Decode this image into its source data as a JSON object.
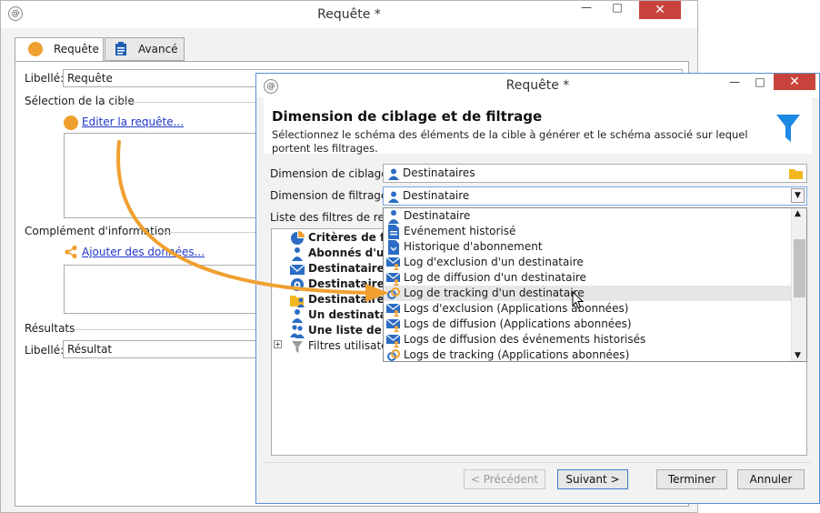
{
  "back_window": {
    "title": "Requête *",
    "tabs": [
      {
        "label": "Requête"
      },
      {
        "label": "Avancé"
      }
    ],
    "libelle_label": "Libellé:",
    "libelle_value": "Requête",
    "section_target": "Sélection de la cible",
    "edit_query_link": "Editer la requête...",
    "section_complement": "Complément d'information",
    "add_data_link": "Ajouter des données...",
    "section_results": "Résultats",
    "result_label": "Libellé:",
    "result_value": "Résultat"
  },
  "dialog": {
    "title": "Requête *",
    "header_title": "Dimension de ciblage et de filtrage",
    "header_desc": "Sélectionnez le schéma des éléments de la cible à générer et le schéma associé sur lequel portent les filtrages.",
    "targeting_label": "Dimension de ciblage:",
    "targeting_value": "Destinataires",
    "filtering_label": "Dimension de filtrage:",
    "filtering_value": "Destinataire",
    "filter_list_label": "Liste des filtres de restri",
    "tree_items": [
      {
        "label": "Critères de filt"
      },
      {
        "label": "Abonnés d'un s"
      },
      {
        "label": "Destinataires c"
      },
      {
        "label": "Destinataires c"
      },
      {
        "label": "Destinataires"
      },
      {
        "label": "Un destinataire"
      },
      {
        "label": "Une liste de de"
      },
      {
        "label": "Filtres utilisateu"
      }
    ],
    "dropdown_items": [
      {
        "label": "Destinataire"
      },
      {
        "label": "Evénement historisé"
      },
      {
        "label": "Historique d'abonnement"
      },
      {
        "label": "Log d'exclusion d'un destinataire"
      },
      {
        "label": "Log de diffusion d'un destinataire"
      },
      {
        "label": "Log de tracking d'un destinataire"
      },
      {
        "label": "Logs d'exclusion (Applications abonnées)"
      },
      {
        "label": "Logs de diffusion (Applications abonnées)"
      },
      {
        "label": "Logs de diffusion des événements historisés"
      },
      {
        "label": "Logs de tracking (Applications abonnées)"
      }
    ],
    "buttons": {
      "previous": "< Précédent",
      "next": "Suivant >",
      "finish": "Terminer",
      "cancel": "Annuler"
    }
  },
  "colors": {
    "accent_orange": "#f0a030",
    "link_blue": "#1f37c7",
    "funnel_blue": "#1e88e5",
    "close_red": "#c8433b"
  }
}
